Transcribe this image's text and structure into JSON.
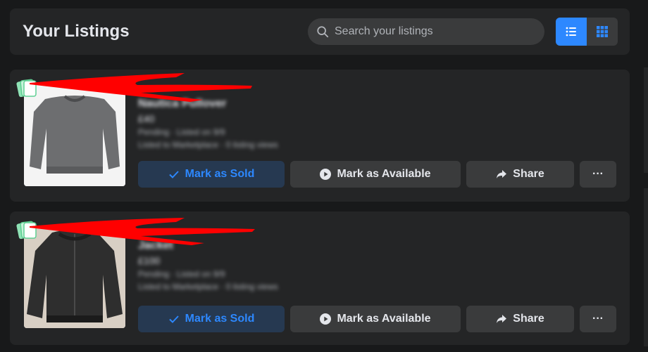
{
  "header": {
    "title": "Your Listings",
    "search_placeholder": "Search your listings",
    "view_list_icon": "list-view-icon",
    "view_grid_icon": "grid-view-icon"
  },
  "listings": [
    {
      "flag": "",
      "title": "Nautica Pullover",
      "price": "£40",
      "status": "Pending · Listed on 9/9",
      "meta": "Listed to Marketplace · 0 listing views",
      "actions": {
        "sold": "Mark as Sold",
        "available": "Mark as Available",
        "share": "Share",
        "more": "···"
      }
    },
    {
      "flag": "",
      "title": "Jacket",
      "price": "£100",
      "status": "Pending · Listed on 9/9",
      "meta": "Listed to Marketplace · 0 listing views",
      "actions": {
        "sold": "Mark as Sold",
        "available": "Mark as Available",
        "share": "Share",
        "more": "···"
      }
    }
  ],
  "colors": {
    "accent": "#2d88ff",
    "card": "#242526",
    "background": "#18191a",
    "redaction": "#ff0000"
  }
}
